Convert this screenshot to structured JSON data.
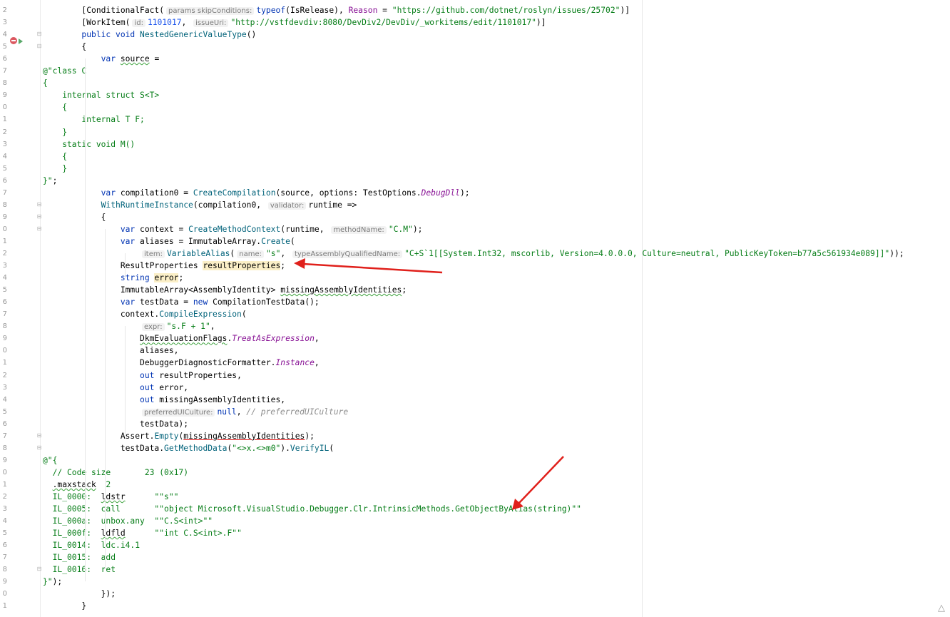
{
  "editor": {
    "lines": [
      {
        "n": "2",
        "tokens": [
          [
            "plain",
            "        [ConditionalFact("
          ],
          [
            "hint",
            "params skipConditions:"
          ],
          [
            "kw",
            "typeof"
          ],
          [
            "plain",
            "(IsRelease), "
          ],
          [
            "named",
            "Reason"
          ],
          [
            "plain",
            " = "
          ],
          [
            "str",
            "\"https://github.com/dotnet/roslyn/issues/25702\""
          ],
          [
            "plain",
            ")]"
          ]
        ]
      },
      {
        "n": "3",
        "tokens": [
          [
            "plain",
            "        [WorkItem("
          ],
          [
            "hint",
            "id:"
          ],
          [
            "num",
            "1101017"
          ],
          [
            "plain",
            ", "
          ],
          [
            "hint",
            "issueUri:"
          ],
          [
            "str",
            "\"http://vstfdevdiv:8080/DevDiv2/DevDiv/_workitems/edit/1101017\""
          ],
          [
            "plain",
            ")]"
          ]
        ]
      },
      {
        "n": "4",
        "tokens": [
          [
            "plain",
            "        "
          ],
          [
            "kw",
            "public void "
          ],
          [
            "method",
            "NestedGenericValueType"
          ],
          [
            "plain",
            "()"
          ]
        ]
      },
      {
        "n": "5",
        "tokens": [
          [
            "plain",
            "        {"
          ]
        ]
      },
      {
        "n": "6",
        "tokens": [
          [
            "plain",
            "            "
          ],
          [
            "kw",
            "var "
          ],
          [
            "warn",
            "source"
          ],
          [
            "plain",
            " ="
          ]
        ]
      },
      {
        "n": "7",
        "tokens": [
          [
            "str",
            "@\"class C"
          ]
        ]
      },
      {
        "n": "8",
        "tokens": [
          [
            "str",
            "{"
          ]
        ]
      },
      {
        "n": "9",
        "tokens": [
          [
            "str",
            "    internal struct S<T>"
          ]
        ]
      },
      {
        "n": "0",
        "tokens": [
          [
            "str",
            "    {"
          ]
        ]
      },
      {
        "n": "1",
        "tokens": [
          [
            "str",
            "        internal T F;"
          ]
        ]
      },
      {
        "n": "2",
        "tokens": [
          [
            "str",
            "    }"
          ]
        ]
      },
      {
        "n": "3",
        "tokens": [
          [
            "str",
            "    static void M()"
          ]
        ]
      },
      {
        "n": "4",
        "tokens": [
          [
            "str",
            "    {"
          ]
        ]
      },
      {
        "n": "5",
        "tokens": [
          [
            "str",
            "    }"
          ]
        ]
      },
      {
        "n": "6",
        "tokens": [
          [
            "str",
            "}\""
          ],
          [
            "plain",
            ";"
          ]
        ]
      },
      {
        "n": "7",
        "tokens": [
          [
            "plain",
            "            "
          ],
          [
            "kw",
            "var "
          ],
          [
            "plain",
            "compilation0 = "
          ],
          [
            "method",
            "CreateCompilation"
          ],
          [
            "plain",
            "(source, options: TestOptions."
          ],
          [
            "static",
            "DebugDll"
          ],
          [
            "plain",
            ");"
          ]
        ]
      },
      {
        "n": "8",
        "tokens": [
          [
            "plain",
            "            "
          ],
          [
            "method",
            "WithRuntimeInstance"
          ],
          [
            "plain",
            "(compilation0, "
          ],
          [
            "hint",
            "validator:"
          ],
          [
            "plain",
            "runtime =>"
          ]
        ]
      },
      {
        "n": "9",
        "tokens": [
          [
            "plain",
            "            {"
          ]
        ]
      },
      {
        "n": "0",
        "tokens": [
          [
            "plain",
            "                "
          ],
          [
            "kw",
            "var "
          ],
          [
            "plain",
            "context = "
          ],
          [
            "method",
            "CreateMethodContext"
          ],
          [
            "plain",
            "(runtime, "
          ],
          [
            "hint",
            "methodName:"
          ],
          [
            "str",
            "\"C.M\""
          ],
          [
            "plain",
            ");"
          ]
        ]
      },
      {
        "n": "1",
        "tokens": [
          [
            "plain",
            "                "
          ],
          [
            "kw",
            "var "
          ],
          [
            "plain",
            "aliases = ImmutableArray."
          ],
          [
            "method",
            "Create"
          ],
          [
            "plain",
            "("
          ]
        ]
      },
      {
        "n": "2",
        "tokens": [
          [
            "plain",
            "                    "
          ],
          [
            "hint",
            "item:"
          ],
          [
            "method",
            "VariableAlias"
          ],
          [
            "plain",
            "("
          ],
          [
            "hint",
            "name:"
          ],
          [
            "str",
            "\"s\""
          ],
          [
            "plain",
            ", "
          ],
          [
            "hint",
            "typeAssemblyQualifiedName:"
          ],
          [
            "str",
            "\"C+S`1[[System.Int32, mscorlib, Version=4.0.0.0, Culture=neutral, PublicKeyToken=b77a5c561934e089]]\""
          ],
          [
            "plain",
            "));"
          ]
        ]
      },
      {
        "n": "3",
        "tokens": [
          [
            "plain",
            "                ResultProperties "
          ],
          [
            "hl",
            "resultProperties"
          ],
          [
            "plain",
            ";"
          ]
        ]
      },
      {
        "n": "4",
        "tokens": [
          [
            "plain",
            "                "
          ],
          [
            "kw",
            "string "
          ],
          [
            "hl",
            "error"
          ],
          [
            "plain",
            ";"
          ]
        ]
      },
      {
        "n": "5",
        "tokens": [
          [
            "plain",
            "                ImmutableArray<AssemblyIdentity> "
          ],
          [
            "warn",
            "missingAssemblyIdentities"
          ],
          [
            "plain",
            ";"
          ]
        ]
      },
      {
        "n": "6",
        "tokens": [
          [
            "plain",
            "                "
          ],
          [
            "kw",
            "var "
          ],
          [
            "plain",
            "testData = "
          ],
          [
            "kw",
            "new "
          ],
          [
            "plain",
            "CompilationTestData();"
          ]
        ]
      },
      {
        "n": "7",
        "tokens": [
          [
            "plain",
            "                context."
          ],
          [
            "method",
            "CompileExpression"
          ],
          [
            "plain",
            "("
          ]
        ]
      },
      {
        "n": "8",
        "tokens": [
          [
            "plain",
            "                    "
          ],
          [
            "hint",
            "expr:"
          ],
          [
            "str",
            "\"s.F + 1\""
          ],
          [
            "plain",
            ","
          ]
        ]
      },
      {
        "n": "9",
        "tokens": [
          [
            "plain",
            "                    "
          ],
          [
            "warn",
            "DkmEvaluationFlags"
          ],
          [
            "plain",
            "."
          ],
          [
            "static",
            "TreatAsExpression"
          ],
          [
            "plain",
            ","
          ]
        ]
      },
      {
        "n": "0",
        "tokens": [
          [
            "plain",
            "                    aliases,"
          ]
        ]
      },
      {
        "n": "1",
        "tokens": [
          [
            "plain",
            "                    DebuggerDiagnosticFormatter."
          ],
          [
            "static",
            "Instance"
          ],
          [
            "plain",
            ","
          ]
        ]
      },
      {
        "n": "2",
        "tokens": [
          [
            "plain",
            "                    "
          ],
          [
            "kw",
            "out "
          ],
          [
            "plain",
            "resultProperties,"
          ]
        ]
      },
      {
        "n": "3",
        "tokens": [
          [
            "plain",
            "                    "
          ],
          [
            "kw",
            "out "
          ],
          [
            "plain",
            "error,"
          ]
        ]
      },
      {
        "n": "4",
        "tokens": [
          [
            "plain",
            "                    "
          ],
          [
            "kw",
            "out "
          ],
          [
            "plain",
            "missingAssemblyIdentities,"
          ]
        ]
      },
      {
        "n": "5",
        "tokens": [
          [
            "plain",
            "                    "
          ],
          [
            "hint",
            "preferredUICulture:"
          ],
          [
            "kw",
            "null"
          ],
          [
            "plain",
            ", "
          ],
          [
            "comment",
            "// preferredUICulture"
          ]
        ]
      },
      {
        "n": "6",
        "tokens": [
          [
            "plain",
            "                    testData);"
          ]
        ]
      },
      {
        "n": "7",
        "tokens": [
          [
            "plain",
            "                Assert."
          ],
          [
            "method",
            "Empty"
          ],
          [
            "plain",
            "("
          ],
          [
            "err",
            "missingAssemblyIdentities"
          ],
          [
            "plain",
            ");"
          ]
        ]
      },
      {
        "n": "8",
        "tokens": [
          [
            "plain",
            "                testData."
          ],
          [
            "method",
            "GetMethodData"
          ],
          [
            "plain",
            "("
          ],
          [
            "str",
            "\"<>x.<>m0\""
          ],
          [
            "plain",
            ")."
          ],
          [
            "method",
            "VerifyIL"
          ],
          [
            "plain",
            "("
          ]
        ]
      },
      {
        "n": "9",
        "tokens": [
          [
            "str",
            "@\"{"
          ]
        ]
      },
      {
        "n": "0",
        "tokens": [
          [
            "str",
            "  // Code size       23 (0x17)"
          ]
        ]
      },
      {
        "n": "1",
        "tokens": [
          [
            "str",
            "  "
          ],
          [
            "warn",
            ".maxstack"
          ],
          [
            "str",
            "  2"
          ]
        ]
      },
      {
        "n": "2",
        "tokens": [
          [
            "str",
            "  IL_0000:  "
          ],
          [
            "warn",
            "ldstr"
          ],
          [
            "str",
            "      \"\"s\"\""
          ]
        ]
      },
      {
        "n": "3",
        "tokens": [
          [
            "str",
            "  IL_0005:  call       \"\"object Microsoft.VisualStudio.Debugger.Clr.IntrinsicMethods.GetObjectByAlias(string)\"\""
          ]
        ]
      },
      {
        "n": "4",
        "tokens": [
          [
            "str",
            "  IL_000a:  unbox.any  \"\"C.S<int>\"\""
          ]
        ]
      },
      {
        "n": "5",
        "tokens": [
          [
            "str",
            "  IL_000f:  "
          ],
          [
            "warn",
            "ldfld"
          ],
          [
            "str",
            "      \"\"int C.S<int>.F\"\""
          ]
        ]
      },
      {
        "n": "6",
        "tokens": [
          [
            "str",
            "  IL_0014:  ldc.i4.1"
          ]
        ]
      },
      {
        "n": "7",
        "tokens": [
          [
            "str",
            "  IL_0015:  add"
          ]
        ]
      },
      {
        "n": "8",
        "tokens": [
          [
            "str",
            "  IL_0016:  ret"
          ]
        ]
      },
      {
        "n": "9",
        "tokens": [
          [
            "str",
            "}\""
          ],
          [
            "plain",
            ");"
          ]
        ]
      },
      {
        "n": "0",
        "tokens": [
          [
            "plain",
            "            });"
          ]
        ]
      },
      {
        "n": "1",
        "tokens": [
          [
            "plain",
            "        }"
          ]
        ]
      }
    ]
  },
  "icons": {
    "breakpoint": "breakpoint-icon",
    "run_gutter": "run-test-icon",
    "corner": "inspection-widget-icon"
  },
  "colors": {
    "keyword": "#0033b3",
    "string": "#067d17",
    "method": "#00627a",
    "named_arg": "#871094",
    "hint_bg": "#f2f2f2",
    "annotation_arrow": "#e0201b",
    "highlight": "#fbefc7"
  }
}
